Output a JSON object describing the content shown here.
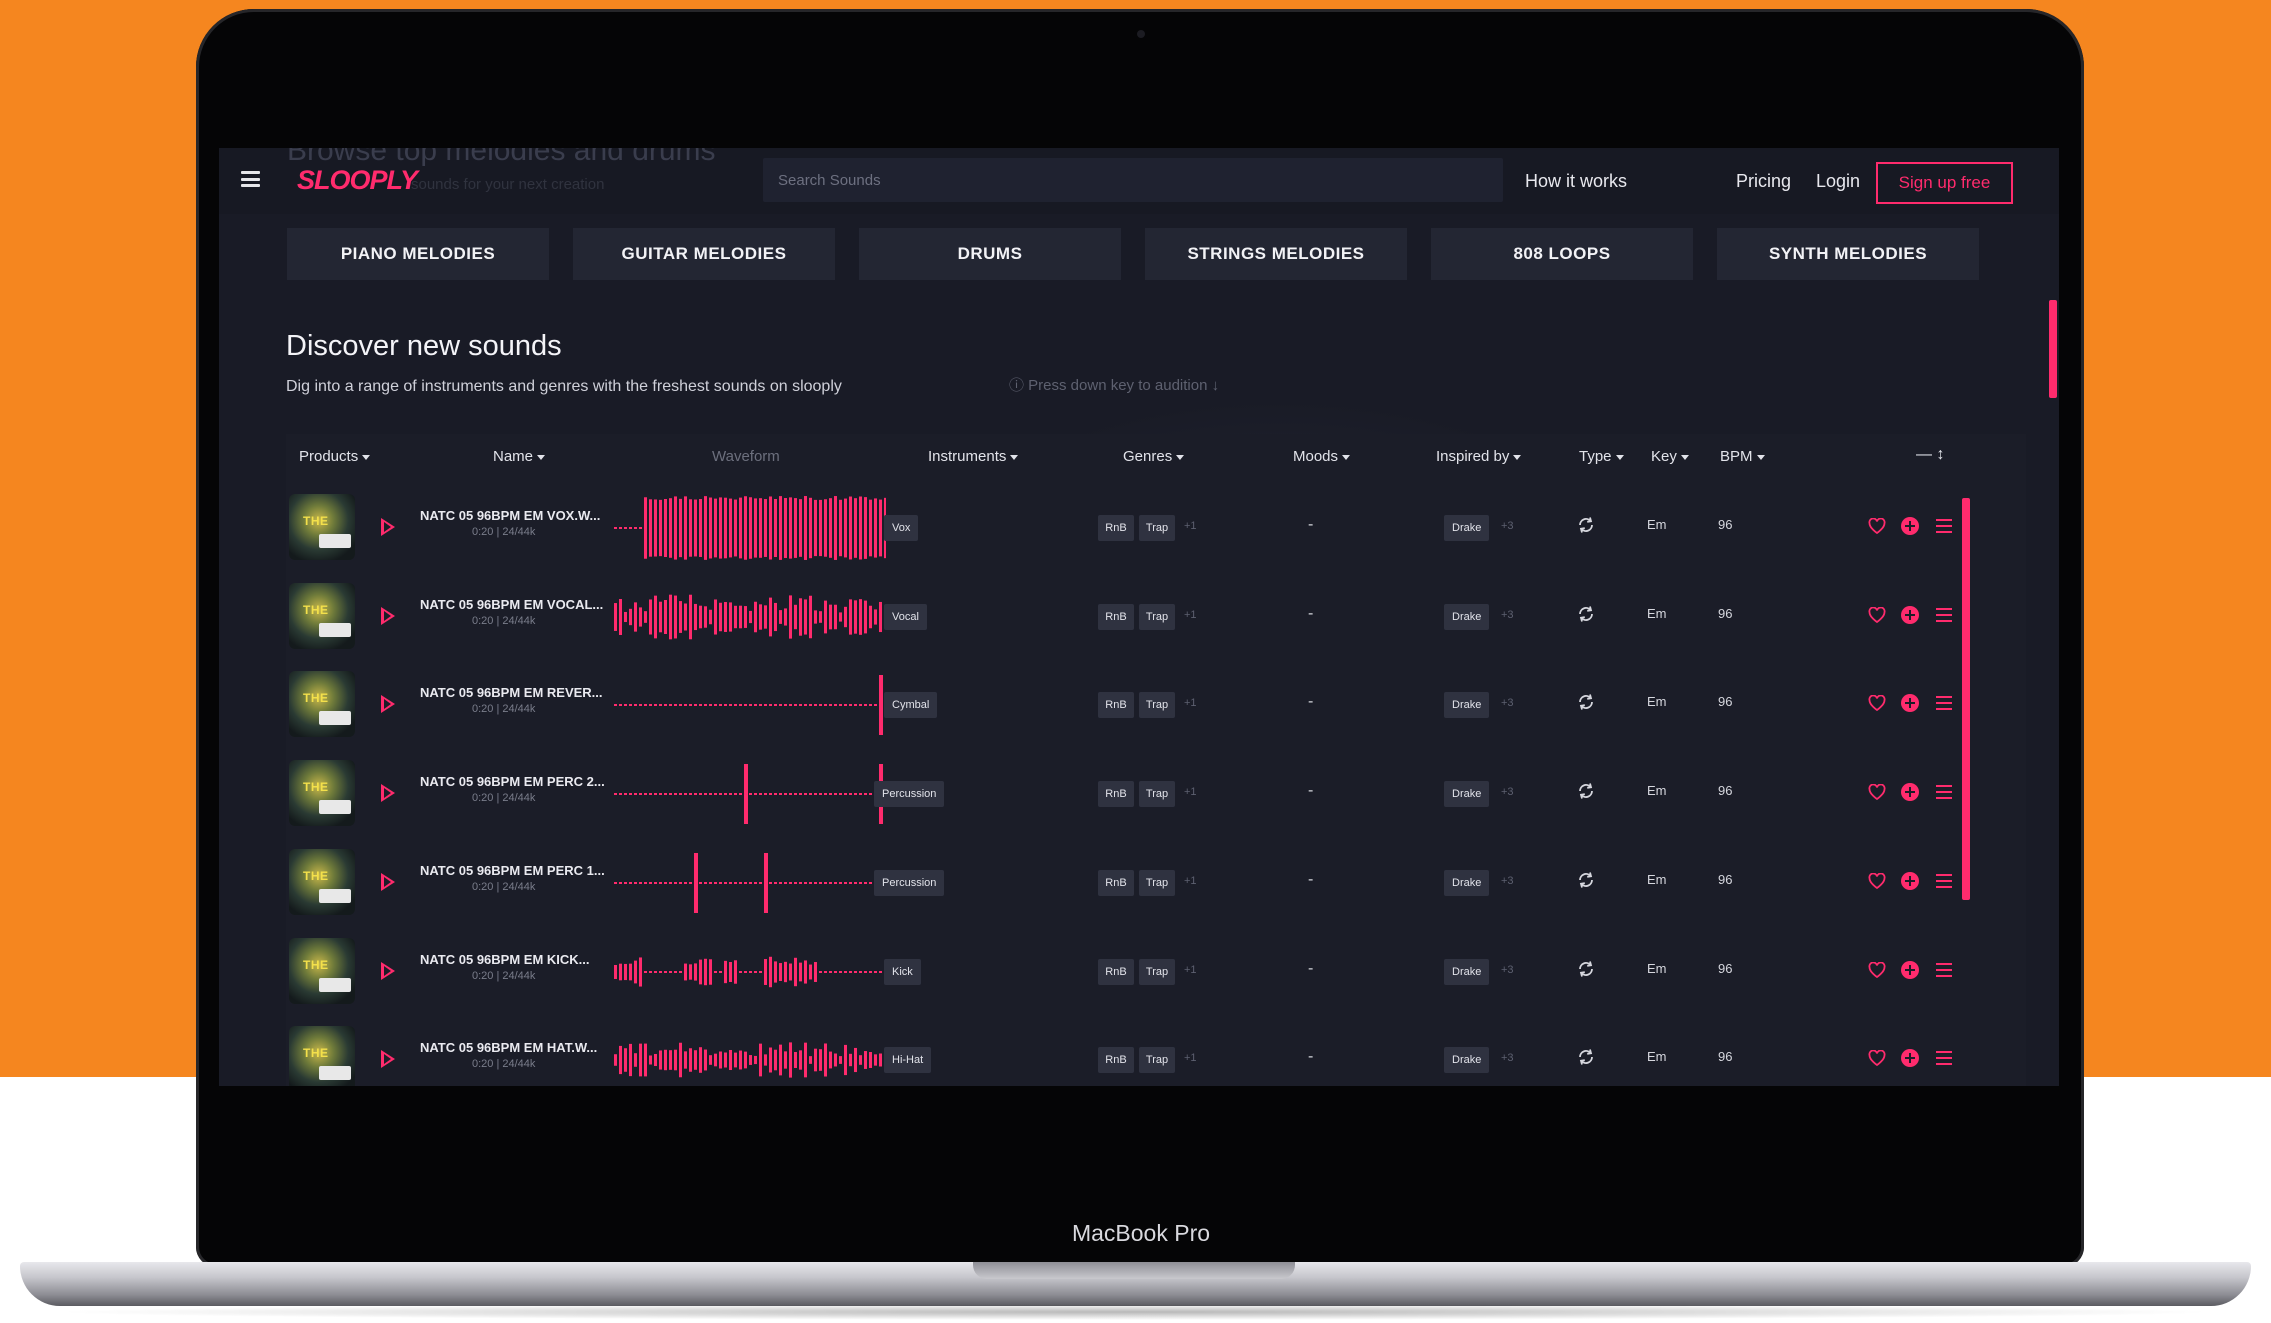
{
  "device": {
    "label": "MacBook Pro"
  },
  "ghost": {
    "heading": "Browse top melodies and drums",
    "sub": "sounds for your next creation"
  },
  "header": {
    "logo": "SLOOPLY",
    "search_placeholder": "Search Sounds",
    "nav": [
      "How it works",
      "Pricing",
      "Login"
    ],
    "signup": "Sign up free"
  },
  "categories": [
    "PIANO MELODIES",
    "GUITAR MELODIES",
    "DRUMS",
    "STRINGS MELODIES",
    "808 LOOPS",
    "SYNTH MELODIES"
  ],
  "discover": {
    "title": "Discover new sounds",
    "description": "Dig into a range of instruments and genres with the freshest sounds on slooply",
    "hint": "ⓘ Press down key to audition ↓"
  },
  "table": {
    "headers": {
      "products": "Products",
      "name": "Name",
      "waveform": "Waveform",
      "instruments": "Instruments",
      "genres": "Genres",
      "moods": "Moods",
      "inspired": "Inspired by",
      "type": "Type",
      "key": "Key",
      "bpm": "BPM",
      "tools": "—   ↕"
    },
    "rows": [
      {
        "name": "NATC 05 96BPM EM VOX.W...",
        "meta": "0:20 | 24/44k",
        "instrument": "Vox",
        "genres": [
          "RnB",
          "Trap"
        ],
        "genres_more": "+1",
        "mood": "-",
        "inspired": "Drake",
        "inspired_more": "+3",
        "key": "Em",
        "bpm": "96"
      },
      {
        "name": "NATC 05 96BPM EM VOCAL...",
        "meta": "0:20 | 24/44k",
        "instrument": "Vocal",
        "genres": [
          "RnB",
          "Trap"
        ],
        "genres_more": "+1",
        "mood": "-",
        "inspired": "Drake",
        "inspired_more": "+3",
        "key": "Em",
        "bpm": "96"
      },
      {
        "name": "NATC 05 96BPM EM REVER...",
        "meta": "0:20 | 24/44k",
        "instrument": "Cymbal",
        "genres": [
          "RnB",
          "Trap"
        ],
        "genres_more": "+1",
        "mood": "-",
        "inspired": "Drake",
        "inspired_more": "+3",
        "key": "Em",
        "bpm": "96"
      },
      {
        "name": "NATC 05 96BPM EM PERC 2...",
        "meta": "0:20 | 24/44k",
        "instrument": "Percussion",
        "genres": [
          "RnB",
          "Trap"
        ],
        "genres_more": "+1",
        "mood": "-",
        "inspired": "Drake",
        "inspired_more": "+3",
        "key": "Em",
        "bpm": "96"
      },
      {
        "name": "NATC 05 96BPM EM PERC 1...",
        "meta": "0:20 | 24/44k",
        "instrument": "Percussion",
        "genres": [
          "RnB",
          "Trap"
        ],
        "genres_more": "+1",
        "mood": "-",
        "inspired": "Drake",
        "inspired_more": "+3",
        "key": "Em",
        "bpm": "96"
      },
      {
        "name": "NATC 05 96BPM EM KICK...",
        "meta": "0:20 | 24/44k",
        "instrument": "Kick",
        "genres": [
          "RnB",
          "Trap"
        ],
        "genres_more": "+1",
        "mood": "-",
        "inspired": "Drake",
        "inspired_more": "+3",
        "key": "Em",
        "bpm": "96"
      },
      {
        "name": "NATC 05 96BPM EM HAT.W...",
        "meta": "0:20 | 24/44k",
        "instrument": "Hi-Hat",
        "genres": [
          "RnB",
          "Trap"
        ],
        "genres_more": "+1",
        "mood": "-",
        "inspired": "Drake",
        "inspired_more": "+3",
        "key": "Em",
        "bpm": "96"
      }
    ]
  },
  "theme": {
    "accent": "#ff2b6d",
    "background": "#191b26",
    "orange": "#f5861f"
  },
  "icons": {
    "menu": "hamburger-icon",
    "play": "play-icon",
    "type": "loop-icon",
    "like": "heart-icon",
    "add": "add-circle-icon",
    "more": "menu-lines-icon",
    "chat": "chat-bubble-icon",
    "up": "chevron-up-icon"
  }
}
